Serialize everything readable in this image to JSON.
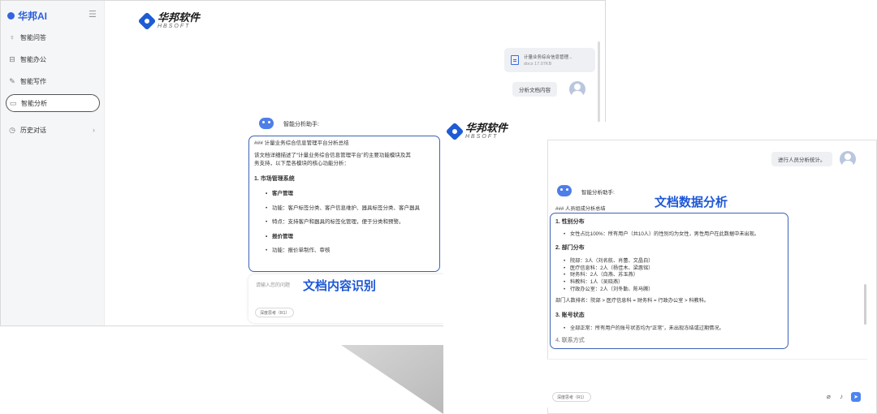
{
  "sidebar": {
    "brand": "华邦AI",
    "items": [
      {
        "label": "智能问答",
        "icon": "lightbulb-icon"
      },
      {
        "label": "智能办公",
        "icon": "office-icon"
      },
      {
        "label": "智能写作",
        "icon": "pen-icon"
      },
      {
        "label": "智能分析",
        "icon": "chat-icon"
      },
      {
        "label": "历史对话",
        "icon": "clock-icon"
      }
    ]
  },
  "logo": {
    "cn": "华邦软件",
    "en": "HBSOFT"
  },
  "window1": {
    "file_card": {
      "name": "计量业务综合信息管理...",
      "meta": "docx 17.07KB"
    },
    "user_message": "分析文档内容",
    "assistant_name": "智能分析助手:",
    "content": {
      "heading": "### 计量业务综合信息管理平台分析总结",
      "intro_1": "该文档详细描述了“计量业务综合信息管理平台”的主要功能模块及其",
      "intro_2": "务支持，以下是各模块的核心功能分析：",
      "section_1": "1. 市场管理系统",
      "sub_1": "客户管理",
      "bullet_1": "功能：客户标签分类、客户信息维护、器具标签分类、客户器具",
      "bullet_2": "特点：支持客户和器具的标签化管理，便于分类和预警。",
      "sub_2": "报价管理",
      "bullet_3": "功能：报价单制作、审核"
    },
    "input_placeholder": "请输入您的问题",
    "chip_label": "深度思考（R1）",
    "highlight_label": "文档内容识别"
  },
  "window2": {
    "user_message": "进行人员分析统计。",
    "assistant_name": "智能分析助手:",
    "highlight_label": "文档数据分析",
    "content": {
      "heading": "### 人员组成分析总结",
      "s1": "1. 性别分布",
      "s1_b1": "女性占比100%：所有用户（共10人）的性别均为女性，男性用户在此数据中未出现。",
      "s2": "2. 部门分布",
      "s2_b1": "院部：3人（刘名航、肖蕾、文晶白）",
      "s2_b2": "医疗信息科：2人（杨佳木、梁惠铭）",
      "s2_b3": "财务科：2人（白燕、苏玉燕）",
      "s2_b4": "科教科：1人（吴晓燕）",
      "s2_b5": "行政办公室：2人（刘冬勤、陈马腾）",
      "rank": "部门人数排名：院部 > 医疗信息科 = 财务科 = 行政办公室 > 科教科。",
      "s3": "3. 账号状态",
      "s3_b1": "全部正常：所有用户的账号状态均为“正常”，未出现冻结或过期情况。",
      "s4": "4. 联系方式"
    },
    "chip_label": "深度思考（R1）"
  }
}
